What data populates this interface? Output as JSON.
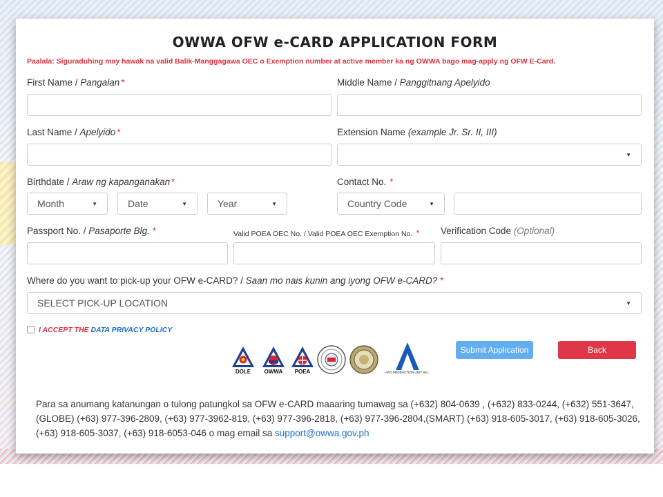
{
  "form": {
    "title": "OWWA OFW e-CARD APPLICATION FORM",
    "notice": "Paalala: Siguraduhing may hawak na valid Balik-Manggagawa OEC o Exemption number at active member ka ng OWWA bago mag-apply ng OFW E-Card."
  },
  "fields": {
    "first_name": {
      "label": "First Name / ",
      "label_tl": "Pangalan",
      "req": "*"
    },
    "middle_name": {
      "label": "Middle Name / ",
      "label_tl": "Panggitnang Apelyido"
    },
    "last_name": {
      "label": "Last Name / ",
      "label_tl": "Apelyido",
      "req": "*"
    },
    "extension_name": {
      "label": "Extension Name ",
      "label_tl": "(example Jr. Sr. II, III)"
    },
    "birthdate": {
      "label": "Birthdate / ",
      "label_tl": "Araw ng kapanganakan",
      "req": "*",
      "month": "Month",
      "day": "Date",
      "year": "Year"
    },
    "contact": {
      "label": "Contact No.",
      "req": "*",
      "country_code": "Country Code"
    },
    "passport": {
      "label": "Passport No. / ",
      "label_tl": "Pasaporte Blg.",
      "req": "*"
    },
    "oec": {
      "label": "Valid POEA OEC No. / Valid POEA OEC Exemption No.",
      "req": "*"
    },
    "verification": {
      "label": "Verification Code ",
      "label_opt": "(Optional)"
    },
    "pickup": {
      "label": "Where do you want to pick-up your OFW e-CARD? / ",
      "label_tl": "Saan mo nais kunin ang iyong OFW e-CARD?",
      "req": "*",
      "selected": "SELECT PICK-UP LOCATION"
    }
  },
  "privacy": {
    "part1": "I ACCEPT THE ",
    "part2": "DATA PRIVACY POLICY"
  },
  "buttons": {
    "submit": "Submit Application",
    "back": "Back"
  },
  "logos": {
    "dole": "DOLE",
    "owwa": "OWWA",
    "poea": "POEA",
    "apo": "APO PRODUCTION UNIT, INC."
  },
  "footer": {
    "text": "Para sa anumang katanungan o tulong patungkol sa OFW e-CARD maaaring tumawag sa (+632) 804-0639 , (+632) 833-0244, (+632) 551-3647, (GLOBE) (+63) 977-396-2809, (+63) 977-3962-819, (+63) 977-396-2818, (+63) 977-396-2804,(SMART) (+63) 918-605-3017, (+63) 918-605-3026, (+63) 918-605-3037, (+63) 918-6053-046 o mag email sa ",
    "email": "support@owwa.gov.ph"
  },
  "colors": {
    "required": "#d9323f",
    "link": "#1a6fd1",
    "submit": "#63aef0",
    "back": "#e0364a"
  }
}
